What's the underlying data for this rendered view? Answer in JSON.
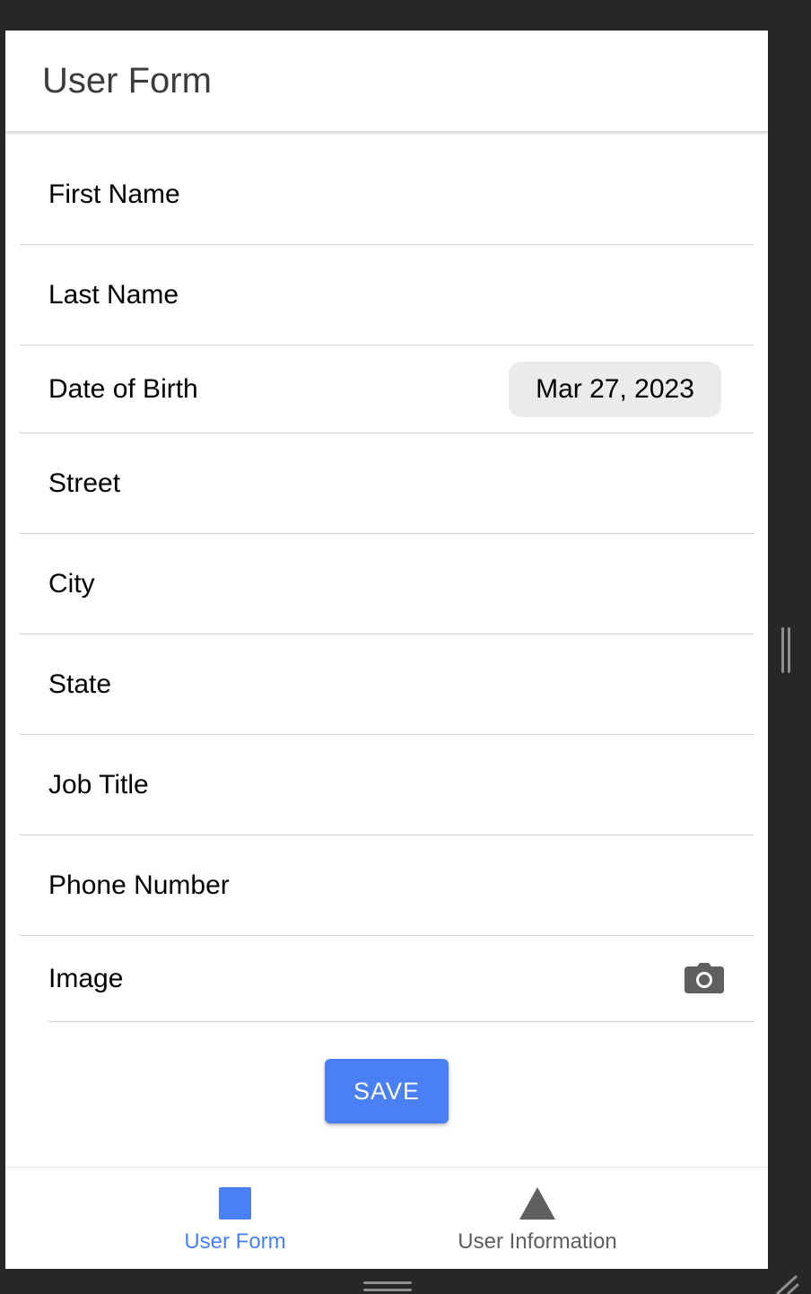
{
  "header": {
    "title": "User Form"
  },
  "form": {
    "fields": [
      {
        "label": "First Name"
      },
      {
        "label": "Last Name"
      },
      {
        "label": "Date of Birth",
        "value": "Mar 27, 2023"
      },
      {
        "label": "Street"
      },
      {
        "label": "City"
      },
      {
        "label": "State"
      },
      {
        "label": "Job Title"
      },
      {
        "label": "Phone Number"
      },
      {
        "label": "Image",
        "icon": "camera-icon"
      }
    ],
    "save_label": "SAVE"
  },
  "tabs": [
    {
      "label": "User Form",
      "icon": "square-icon",
      "active": true
    },
    {
      "label": "User Information",
      "icon": "triangle-icon",
      "active": false
    }
  ],
  "colors": {
    "accent": "#4a80f5",
    "active_tab": "#4a80f5",
    "inactive_tab": "#5f5f5f",
    "app_background": "#262729"
  }
}
